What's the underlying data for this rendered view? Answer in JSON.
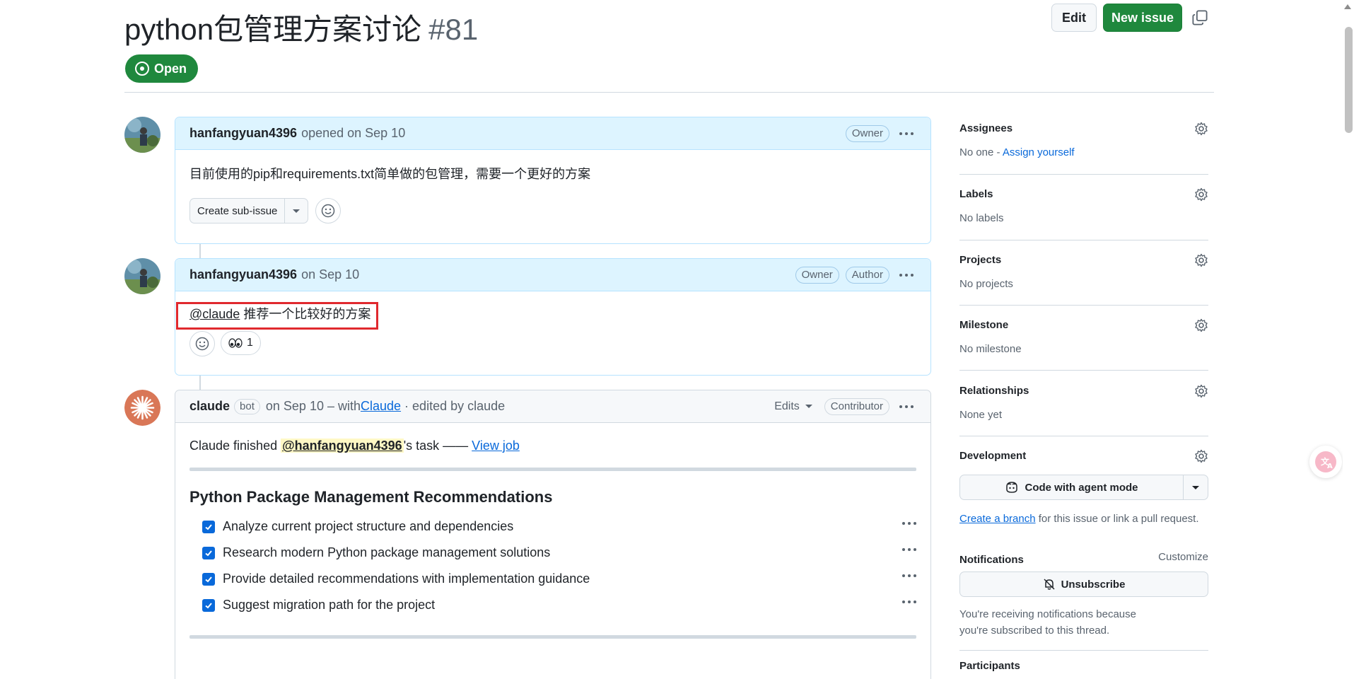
{
  "issue": {
    "title": "python包管理方案讨论",
    "number": "#81",
    "state": "Open",
    "edit_label": "Edit",
    "new_issue_label": "New issue"
  },
  "comments": [
    {
      "author": "hanfangyuan4396",
      "meta": "opened on Sep 10",
      "labels": [
        "Owner"
      ],
      "body": "目前使用的pip和requirements.txt简单做的包管理，需要一个更好的方案",
      "sub_issue_label": "Create sub-issue"
    },
    {
      "author": "hanfangyuan4396",
      "meta": "on Sep 10",
      "labels": [
        "Owner",
        "Author"
      ],
      "mention": "@claude",
      "body": " 推荐一个比较好的方案",
      "reaction_count": "1"
    },
    {
      "author": "claude",
      "bot_label": "bot",
      "meta_prefix": "on Sep 10 – with ",
      "meta_link": "Claude",
      "meta_suffix": " · edited by claude",
      "edits_label": "Edits",
      "labels": [
        "Contributor"
      ],
      "task_prefix": "Claude finished ",
      "task_mention": "@hanfangyuan4396",
      "task_suffix": "'s task —— ",
      "task_link": "View job",
      "heading": "Python Package Management Recommendations",
      "tasks": [
        "Analyze current project structure and dependencies",
        "Research modern Python package management solutions",
        "Provide detailed recommendations with implementation guidance",
        "Suggest migration path for the project"
      ]
    }
  ],
  "sidebar": {
    "assignees": {
      "title": "Assignees",
      "value_prefix": "No one - ",
      "value_link": "Assign yourself"
    },
    "labels": {
      "title": "Labels",
      "value": "No labels"
    },
    "projects": {
      "title": "Projects",
      "value": "No projects"
    },
    "milestone": {
      "title": "Milestone",
      "value": "No milestone"
    },
    "relationships": {
      "title": "Relationships",
      "value": "None yet"
    },
    "development": {
      "title": "Development",
      "button_label": "Code with agent mode",
      "branch_link": "Create a branch",
      "branch_suffix": " for this issue or link a pull request."
    },
    "notifications": {
      "title": "Notifications",
      "customize": "Customize",
      "button_label": "Unsubscribe",
      "note": "You're receiving notifications because you're subscribed to this thread."
    },
    "participants": {
      "title": "Participants"
    }
  },
  "colors": {
    "open_green": "#1f883d",
    "link_blue": "#0969da",
    "comment_header_blue": "#ddf4ff",
    "highlight_red": "#e0292e",
    "claude_orange": "#d97757"
  }
}
